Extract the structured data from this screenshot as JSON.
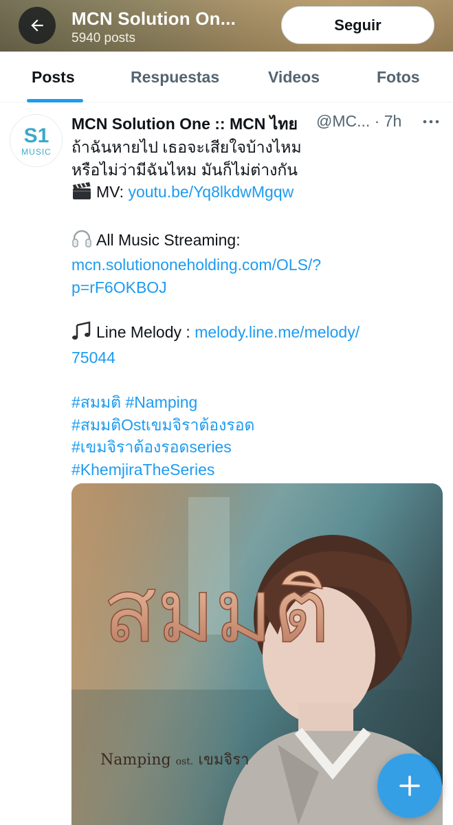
{
  "header": {
    "title": "MCN Solution On...",
    "subtitle": "5940 posts",
    "follow_label": "Seguir",
    "back_icon": "arrow-left-icon"
  },
  "tabs": [
    {
      "label": "Posts",
      "active": true
    },
    {
      "label": "Respuestas",
      "active": false
    },
    {
      "label": "Videos",
      "active": false
    },
    {
      "label": "Fotos",
      "active": false
    }
  ],
  "post": {
    "avatar_logo": "S1",
    "avatar_logo_sub": "MUSIC",
    "author": "MCN Solution One :: MCN ไทย",
    "handle_time": "@MC... · 7h",
    "more_icon": "more-horizontal-icon",
    "lines": {
      "l1": "ถ้าฉันหายไป เธอจะเสียใจบ้างไหม",
      "l2": "หรือไม่ว่ามีฉันไหม มันก็ไม่ต่างกัน",
      "mv_label": "MV: ",
      "mv_link": "youtu.be/Yq8lkdwMgqw",
      "streaming_label": "All Music Streaming:",
      "streaming_link_1": "mcn.solutiononeholding.com/OLS/?",
      "streaming_link_2": "p=rF6OKBOJ",
      "melody_label": "Line Melody : ",
      "melody_link_1": "melody.line.me/melody/",
      "melody_link_2": "75044",
      "hashtag_1a": "#สมมติ",
      "hashtag_1b": "#Namping",
      "hashtag_2": "#สมมติOstเขมจิราต้องรอด",
      "hashtag_3": "#เขมจิราต้องรอดseries",
      "hashtag_4": "#KhemjiraTheSeries"
    },
    "icons": {
      "mv": "clapper-board-icon",
      "streaming": "headphones-icon",
      "melody": "music-notes-icon"
    },
    "media": {
      "title_art": "สมมติ",
      "caption_artist": "Namping",
      "caption_ost": "ost.",
      "caption_logo": "เขมจิรา"
    }
  },
  "fab": {
    "icon": "plus-icon"
  },
  "colors": {
    "accent": "#1d9bf0",
    "text": "#0f1419",
    "muted": "#536471"
  }
}
